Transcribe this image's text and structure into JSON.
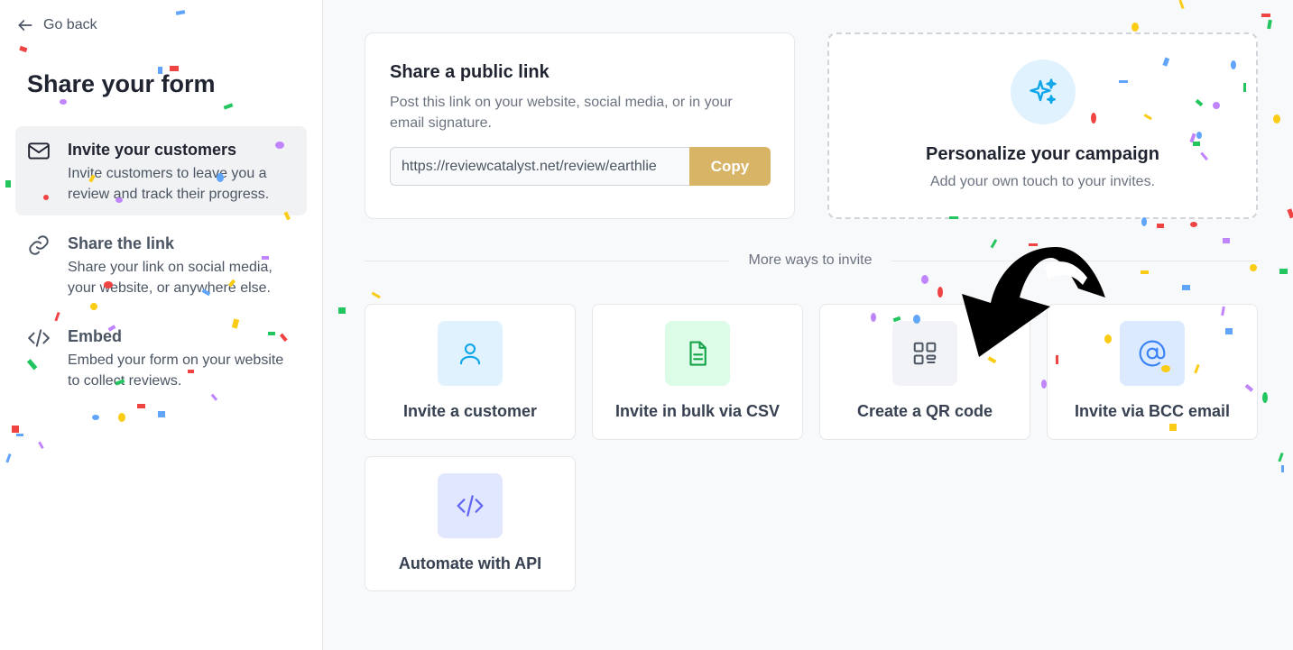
{
  "sidebar": {
    "go_back": "Go back",
    "title": "Share your form",
    "items": [
      {
        "title": "Invite your customers",
        "desc": "Invite customers to leave you a review and track their progress."
      },
      {
        "title": "Share the link",
        "desc": "Share your link on social media, your website, or anywhere else."
      },
      {
        "title": "Embed",
        "desc": "Embed your form on your website to collect reviews."
      }
    ]
  },
  "public_link": {
    "title": "Share a public link",
    "desc": "Post this link on your website, social media, or in your email signature.",
    "url": "https://reviewcatalyst.net/review/earthlie",
    "copy_label": "Copy"
  },
  "personalize": {
    "title": "Personalize your campaign",
    "desc": "Add your own touch to your invites."
  },
  "more_ways_label": "More ways to invite",
  "options": [
    {
      "label": "Invite a customer",
      "icon": "user-icon"
    },
    {
      "label": "Invite in bulk via CSV",
      "icon": "file-icon"
    },
    {
      "label": "Create a QR code",
      "icon": "qr-code-icon"
    },
    {
      "label": "Invite via BCC email",
      "icon": "at-sign-icon"
    },
    {
      "label": "Automate with API",
      "icon": "code-icon"
    }
  ],
  "colors": {
    "accent": "#d8b466",
    "sparkle_bg": "#e0f2fe",
    "user_icon_bg": "#e0f2fe",
    "csv_icon_bg": "#dcfce7",
    "qr_icon_bg": "#f1f3f6",
    "bcc_icon_bg": "#dbeafe",
    "api_icon_bg": "#e0e7ff"
  }
}
